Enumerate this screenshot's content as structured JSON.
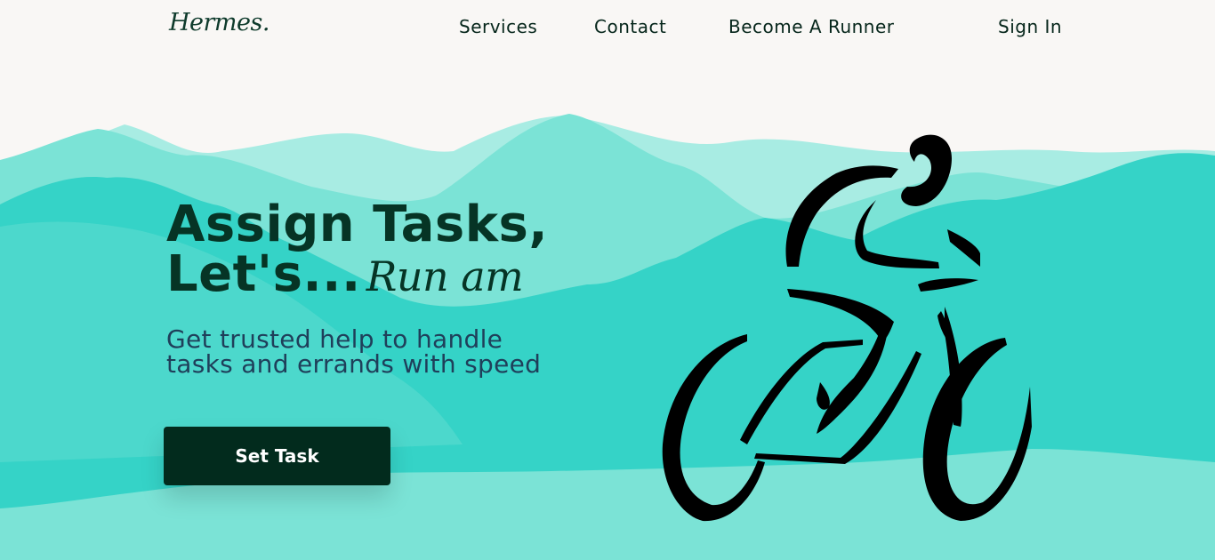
{
  "brand": {
    "logo": "Hermes."
  },
  "nav": {
    "services": "Services",
    "contact": "Contact",
    "become_runner": "Become A Runner",
    "sign_in": "Sign In"
  },
  "hero": {
    "title_line1": "Assign Tasks,",
    "title_line2_prefix": "Let's...",
    "title_line2_script": "Run am",
    "subtitle_line1": "Get trusted help to handle",
    "subtitle_line2": "tasks and errands with speed",
    "cta_label": "Set Task"
  },
  "colors": {
    "background": "#f9f7f5",
    "mountain_light": "#a8ece3",
    "mountain_mid": "#7be3d6",
    "mountain_main": "#35d3c7",
    "headline": "#063425",
    "button": "#022b1d"
  },
  "illustration": {
    "name": "cyclist-illustration"
  }
}
